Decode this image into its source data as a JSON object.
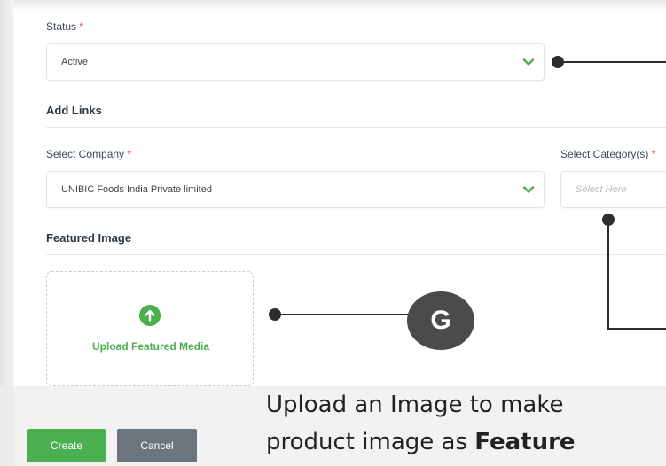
{
  "form": {
    "status": {
      "label": "Status",
      "required_mark": "*",
      "value": "Active"
    },
    "add_links_heading": "Add Links",
    "company": {
      "label": "Select Company",
      "required_mark": "*",
      "value": "UNIBIC Foods India Private limited"
    },
    "category": {
      "label": "Select Category(s)",
      "required_mark": "*",
      "placeholder": "Select Here"
    },
    "featured_image_heading": "Featured Image",
    "upload_label": "Upload Featured Media"
  },
  "actions": {
    "create_label": "Create",
    "cancel_label": "Cancel"
  },
  "annotation": {
    "badge": "G",
    "callout_line1": "Upload an Image to make",
    "callout_line2_prefix": "product image as ",
    "callout_line2_bold": "Feature"
  },
  "colors": {
    "accent_green": "#4caf50",
    "required_red": "#e53935",
    "cancel_gray": "#6c757d",
    "annotation_dark": "#2d2d2d"
  },
  "icons": {
    "dropdown": "chevron-down-icon",
    "upload": "arrow-up-circle-icon"
  }
}
